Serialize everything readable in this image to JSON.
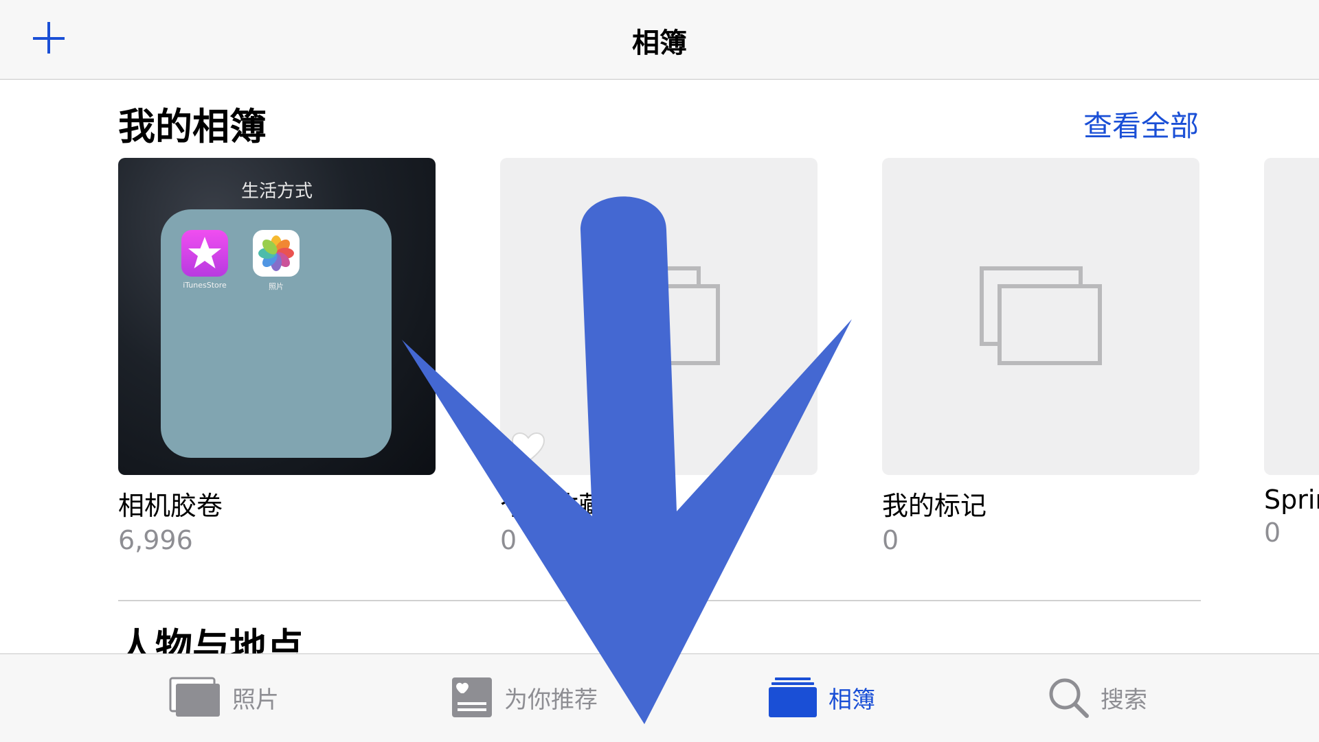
{
  "navbar": {
    "title": "相簿"
  },
  "my_albums": {
    "section_title": "我的相簿",
    "see_all_label": "查看全部",
    "albums": [
      {
        "title": "相机胶卷",
        "count": "6,996",
        "thumbnail": {
          "folder_name": "生活方式",
          "apps": [
            {
              "label": "iTunesStore",
              "icon": "itunes-store-icon"
            },
            {
              "label": "照片",
              "icon": "photos-icon"
            }
          ]
        }
      },
      {
        "title": "个人收藏",
        "count": "0",
        "icon": "heart-icon"
      },
      {
        "title": "我的标记",
        "count": "0"
      },
      {
        "title": "Sprin",
        "count": "0"
      }
    ]
  },
  "people_places": {
    "section_title": "人物与地点"
  },
  "tabbar": {
    "tabs": [
      {
        "label": "照片",
        "icon": "photos-tab-icon",
        "active": false
      },
      {
        "label": "为你推荐",
        "icon": "for-you-tab-icon",
        "active": false
      },
      {
        "label": "相簿",
        "icon": "albums-tab-icon",
        "active": true
      },
      {
        "label": "搜索",
        "icon": "search-tab-icon",
        "active": false
      }
    ]
  },
  "colors": {
    "accent": "#1a4fd6",
    "arrow_overlay": "#4468d2",
    "inactive": "#8e8e93"
  },
  "overlay": {
    "arrow_icon": "down-arrow-icon"
  }
}
